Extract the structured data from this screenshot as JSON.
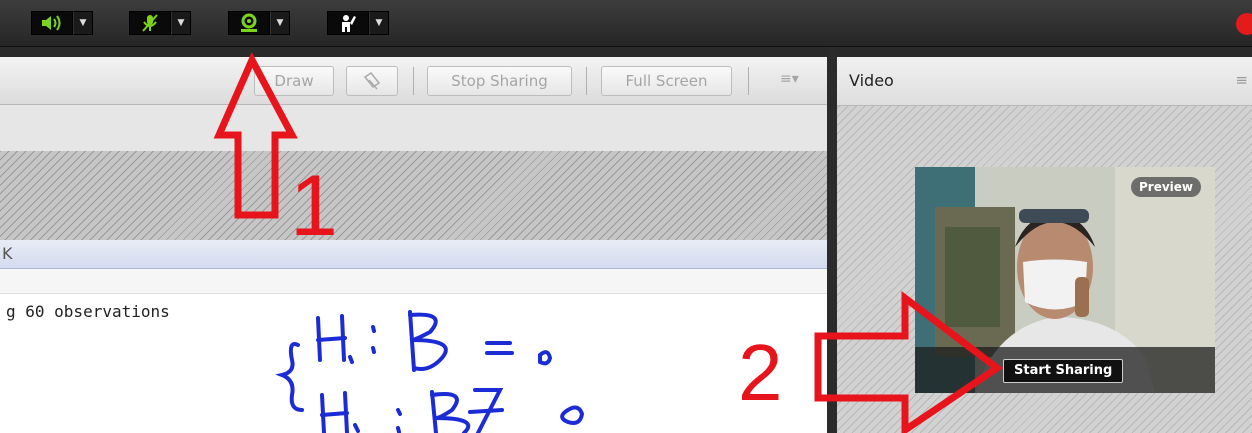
{
  "toolbar": {
    "buttons": [
      {
        "icon": "speaker-icon",
        "color": "#7cd31b"
      },
      {
        "icon": "microphone-muted-icon",
        "color": "#7cd31b"
      },
      {
        "icon": "webcam-icon",
        "color": "#7cd31b"
      },
      {
        "icon": "raise-hand-icon",
        "color": "#ffffff"
      }
    ],
    "record_indicator_color": "#e21b1b"
  },
  "share_pod": {
    "draw_label": "Draw",
    "stop_sharing_label": "Stop Sharing",
    "full_screen_label": "Full Screen",
    "window_title_fragment": "K",
    "code_line": "g 60 observations"
  },
  "video_pod": {
    "title": "Video",
    "preview_label": "Preview",
    "start_sharing_label": "Start Sharing"
  },
  "annotations": {
    "label_1": "1",
    "label_2": "2",
    "arrow_color": "#e8141c",
    "ink_color": "#1b2bd6"
  }
}
